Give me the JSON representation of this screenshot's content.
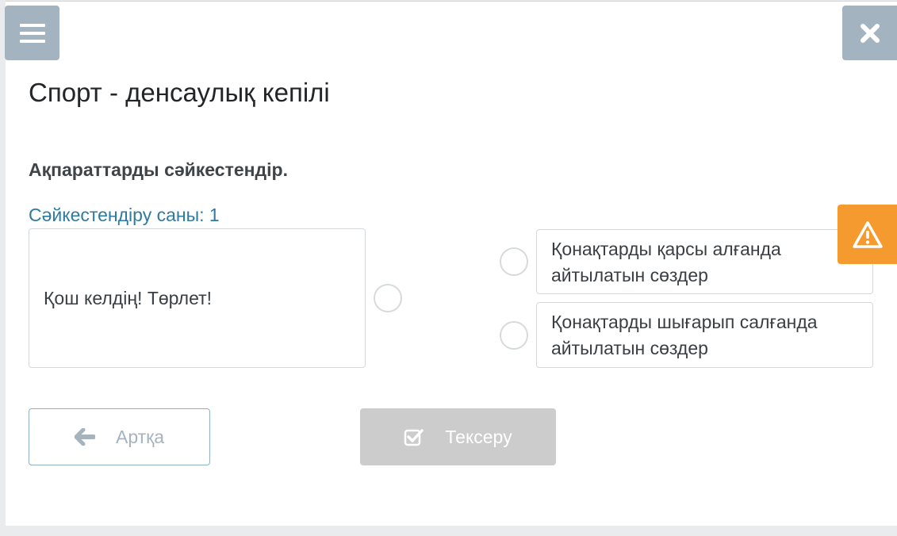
{
  "header": {
    "menu_icon": "hamburger-menu-icon",
    "close_icon": "close-x-icon"
  },
  "page": {
    "title": "Спорт - денсаулық кепілі",
    "instruction": "Ақпараттарды сәйкестендір.",
    "match_count": "Сәйкестендіру саны: 1"
  },
  "matching": {
    "left_items": [
      {
        "label": "Қош келдің! Төрлет!"
      }
    ],
    "right_items": [
      {
        "line1": "Қонақтарды қарсы алғанда",
        "line2": "айтылатын сөздер"
      },
      {
        "line1": "Қонақтарды шығарып салғанда",
        "line2": "айтылатын сөздер"
      }
    ]
  },
  "buttons": {
    "back_label": "Артқа",
    "back_icon": "arrow-left-icon",
    "check_label": "Тексеру",
    "check_icon": "checkbox-check-icon"
  },
  "side": {
    "warning_icon": "warning-triangle-icon"
  },
  "colors": {
    "side_button": "#a3b3bf",
    "warning": "#f59a2f",
    "link_text": "#2f7aa0",
    "disabled_button": "#cccccc"
  }
}
